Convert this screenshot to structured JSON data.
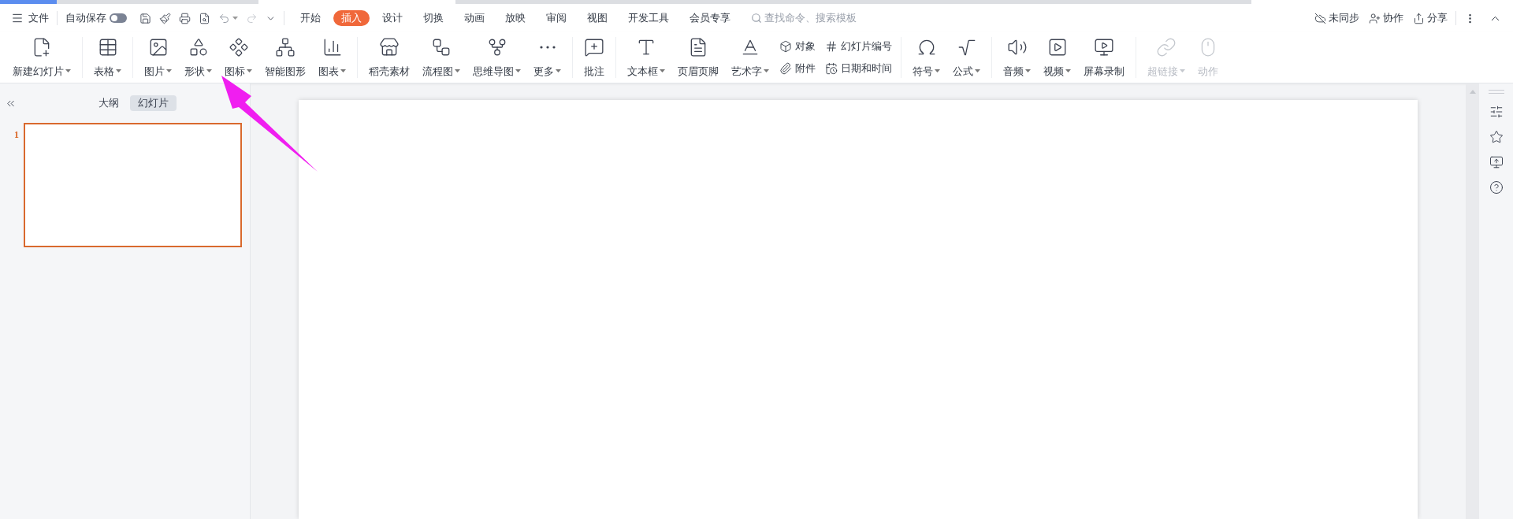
{
  "menu_bar": {
    "file": "文件",
    "autosave": {
      "label": "自动保存",
      "on": false
    },
    "tabs": [
      {
        "label": "开始",
        "selected": false
      },
      {
        "label": "插入",
        "selected": true
      },
      {
        "label": "设计",
        "selected": false
      },
      {
        "label": "切换",
        "selected": false
      },
      {
        "label": "动画",
        "selected": false
      },
      {
        "label": "放映",
        "selected": false
      },
      {
        "label": "审阅",
        "selected": false
      },
      {
        "label": "视图",
        "selected": false
      },
      {
        "label": "开发工具",
        "selected": false
      },
      {
        "label": "会员专享",
        "selected": false
      }
    ],
    "search": {
      "placeholder": "查找命令、搜索模板"
    },
    "actions": [
      "未同步",
      "协作",
      "分享"
    ]
  },
  "ribbon": {
    "groups": [
      [
        {
          "label": "新建幻灯片",
          "dropdown": true,
          "disabled": false
        }
      ],
      [
        {
          "label": "表格",
          "dropdown": true,
          "disabled": false
        }
      ],
      [
        {
          "label": "图片",
          "dropdown": true,
          "disabled": false
        },
        {
          "label": "形状",
          "dropdown": true,
          "disabled": false
        },
        {
          "label": "图标",
          "dropdown": true,
          "disabled": false
        },
        {
          "label": "智能图形",
          "dropdown": false,
          "disabled": false
        },
        {
          "label": "图表",
          "dropdown": true,
          "disabled": false
        }
      ],
      [
        {
          "label": "稻壳素材",
          "dropdown": false,
          "disabled": false
        },
        {
          "label": "流程图",
          "dropdown": true,
          "disabled": false
        },
        {
          "label": "思维导图",
          "dropdown": true,
          "disabled": false
        },
        {
          "label": "更多",
          "dropdown": true,
          "disabled": false
        }
      ],
      [
        {
          "label": "批注",
          "dropdown": false,
          "disabled": false
        }
      ],
      [
        {
          "label": "文本框",
          "dropdown": true,
          "disabled": false
        },
        {
          "label": "页眉页脚",
          "dropdown": false,
          "disabled": false
        },
        {
          "label": "艺术字",
          "dropdown": true,
          "disabled": false
        },
        {
          "label": "对象",
          "kind": "small",
          "dropdown": false,
          "disabled": false
        },
        {
          "label": "附件",
          "kind": "small",
          "dropdown": false,
          "disabled": false
        },
        {
          "label": "幻灯片编号",
          "kind": "small",
          "dropdown": false,
          "disabled": false
        },
        {
          "label": "日期和时间",
          "kind": "small",
          "dropdown": false,
          "disabled": false
        }
      ],
      [
        {
          "label": "符号",
          "dropdown": true,
          "disabled": false
        },
        {
          "label": "公式",
          "dropdown": true,
          "disabled": false
        }
      ],
      [
        {
          "label": "音频",
          "dropdown": true,
          "disabled": false
        },
        {
          "label": "视频",
          "dropdown": true,
          "disabled": false
        },
        {
          "label": "屏幕录制",
          "dropdown": false,
          "disabled": false
        }
      ],
      [
        {
          "label": "超链接",
          "dropdown": true,
          "disabled": true
        },
        {
          "label": "动作",
          "dropdown": false,
          "disabled": true
        }
      ]
    ]
  },
  "left_panel": {
    "tabs": [
      {
        "label": "大纲",
        "selected": false
      },
      {
        "label": "幻灯片",
        "selected": true
      }
    ],
    "slides": [
      {
        "number": "1",
        "selected": true
      }
    ]
  }
}
